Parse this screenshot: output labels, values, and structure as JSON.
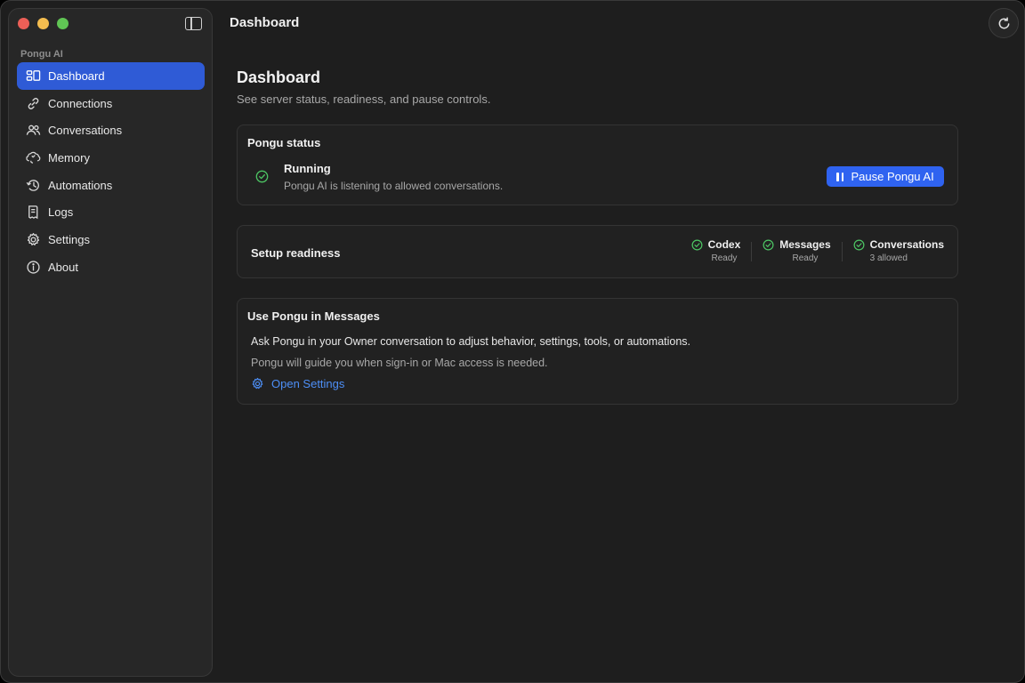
{
  "sidebar": {
    "section_label": "Pongu AI",
    "items": [
      {
        "label": "Dashboard",
        "icon": "dashboard-icon"
      },
      {
        "label": "Connections",
        "icon": "link-icon"
      },
      {
        "label": "Conversations",
        "icon": "people-icon"
      },
      {
        "label": "Memory",
        "icon": "brain-icon"
      },
      {
        "label": "Automations",
        "icon": "history-icon"
      },
      {
        "label": "Logs",
        "icon": "document-icon"
      },
      {
        "label": "Settings",
        "icon": "gear-icon"
      },
      {
        "label": "About",
        "icon": "info-icon"
      }
    ],
    "active_index": 0
  },
  "header": {
    "title": "Dashboard"
  },
  "main": {
    "title": "Dashboard",
    "subtitle": "See server status, readiness, and pause controls.",
    "status_card": {
      "title": "Pongu status",
      "state": "Running",
      "description": "Pongu AI is listening to allowed conversations.",
      "pause_label": "Pause Pongu AI"
    },
    "readiness_card": {
      "title": "Setup readiness",
      "items": [
        {
          "label": "Codex",
          "status": "Ready"
        },
        {
          "label": "Messages",
          "status": "Ready"
        },
        {
          "label": "Conversations",
          "status": "3 allowed"
        }
      ]
    },
    "messages_card": {
      "title": "Use Pongu in Messages",
      "line1": "Ask Pongu in your Owner conversation to adjust behavior, settings, tools, or automations.",
      "line2": "Pongu will guide you when sign-in or Mac access is needed.",
      "link_label": "Open Settings"
    }
  },
  "colors": {
    "accent": "#2f5bd6",
    "button": "#2f63f0",
    "success": "#4cc463",
    "link": "#4d8ff7"
  }
}
